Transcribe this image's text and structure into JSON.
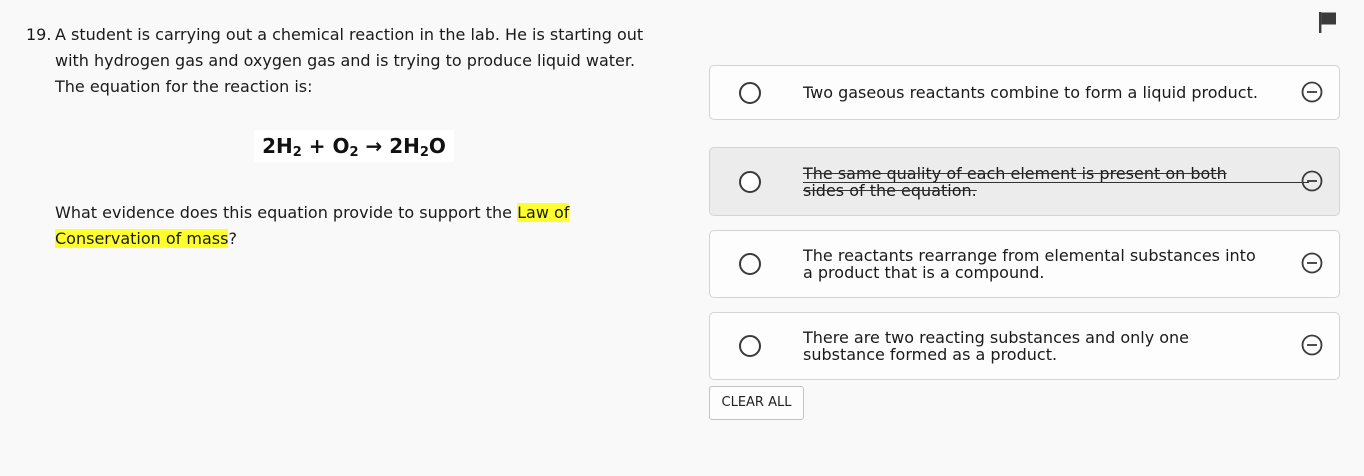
{
  "question": {
    "number": "19.",
    "lines": [
      "A student is carrying out a chemical reaction in the lab. He is starting out",
      "with hydrogen gas and oxygen gas and is trying to produce liquid water.",
      "The equation for the reaction is:"
    ],
    "equation": {
      "left_coef": "2H",
      "left_sub": "2",
      "plus": " + O",
      "o_sub": "2",
      "arrow": " → 2H",
      "h_sub": "2",
      "tail": "O"
    },
    "prompt_before": "What evidence does this equation provide to support the ",
    "prompt_highlight_1": "Law of",
    "prompt_highlight_2": "Conservation of mass",
    "prompt_after": "?"
  },
  "answers": [
    {
      "text": "Two gaseous reactants combine to form a liquid product.",
      "eliminated": false
    },
    {
      "text": "The same quality of each element is present on both sides of the equation.",
      "eliminated": true
    },
    {
      "text": "The reactants rearrange from elemental substances into a product that is a compound.",
      "eliminated": false
    },
    {
      "text": "There are two reacting substances and only one substance formed as a product.",
      "eliminated": false
    }
  ],
  "icons": {
    "flag": "flag-icon",
    "eliminate": "minus-circle-icon",
    "radio": "radio-icon"
  },
  "controls": {
    "clear_all": "CLEAR ALL"
  },
  "colors": {
    "highlight": "#ffff2e",
    "eliminated_bg": "#ececec"
  }
}
